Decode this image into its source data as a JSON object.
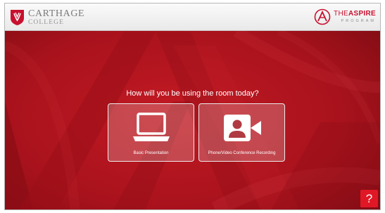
{
  "header": {
    "college_name": "CARTHAGE",
    "college_sub": "COLLEGE",
    "aspire_the": "THE",
    "aspire_word": "ASPIRE",
    "aspire_program": "PROGRAM"
  },
  "main": {
    "prompt": "How will you be using the room today?",
    "options": [
      {
        "label": "Basic Presentation",
        "icon": "laptop-icon"
      },
      {
        "label": "Phone/Video Conference Recording",
        "icon": "video-camera-icon"
      }
    ]
  },
  "help": {
    "label": "?"
  },
  "colors": {
    "background": "#a9141d",
    "accent": "#c8102e",
    "help_button": "#e01826",
    "header_bg": "#f2f2f2"
  }
}
